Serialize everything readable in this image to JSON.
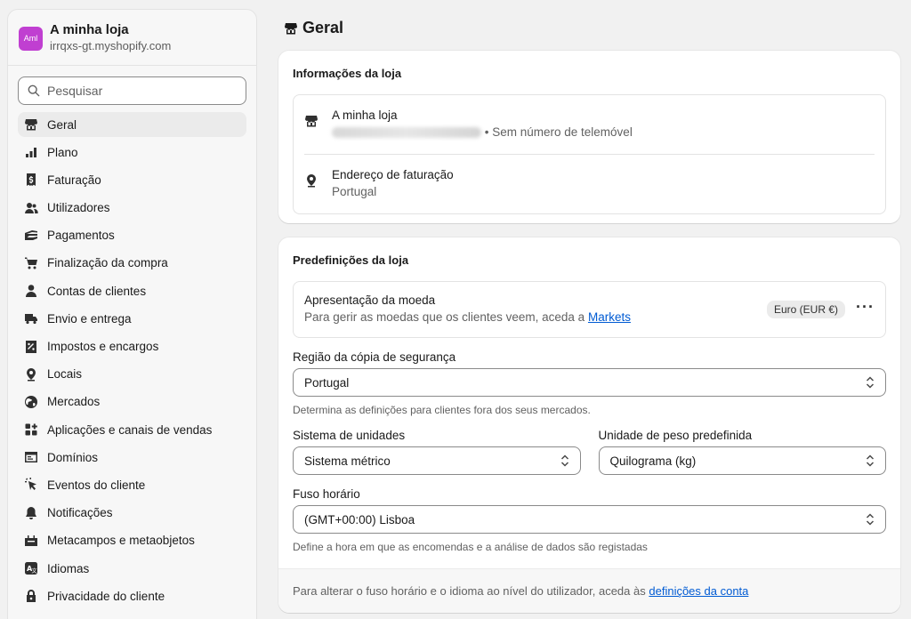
{
  "store": {
    "avatar_text": "Aml",
    "name": "A minha loja",
    "url": "irrqxs-gt.myshopify.com"
  },
  "search": {
    "placeholder": "Pesquisar"
  },
  "nav": [
    {
      "label": "Geral",
      "icon": "store-icon"
    },
    {
      "label": "Plano",
      "icon": "chart-icon"
    },
    {
      "label": "Faturação",
      "icon": "receipt-icon"
    },
    {
      "label": "Utilizadores",
      "icon": "users-icon"
    },
    {
      "label": "Pagamentos",
      "icon": "payments-icon"
    },
    {
      "label": "Finalização da compra",
      "icon": "cart-icon"
    },
    {
      "label": "Contas de clientes",
      "icon": "person-icon"
    },
    {
      "label": "Envio e entrega",
      "icon": "truck-icon"
    },
    {
      "label": "Impostos e encargos",
      "icon": "tax-icon"
    },
    {
      "label": "Locais",
      "icon": "location-icon"
    },
    {
      "label": "Mercados",
      "icon": "globe-icon"
    },
    {
      "label": "Aplicações e canais de vendas",
      "icon": "apps-icon"
    },
    {
      "label": "Domínios",
      "icon": "domain-icon"
    },
    {
      "label": "Eventos do cliente",
      "icon": "cursor-icon"
    },
    {
      "label": "Notificações",
      "icon": "bell-icon"
    },
    {
      "label": "Metacampos e metaobjetos",
      "icon": "metafield-icon"
    },
    {
      "label": "Idiomas",
      "icon": "language-icon"
    },
    {
      "label": "Privacidade do cliente",
      "icon": "lock-icon"
    }
  ],
  "page": {
    "title": "Geral"
  },
  "store_info": {
    "title": "Informações da loja",
    "name": "A minha loja",
    "phone": "• Sem número de telemóvel",
    "billing_title": "Endereço de faturação",
    "billing_value": "Portugal"
  },
  "defaults": {
    "title": "Predefinições da loja",
    "currency_title": "Apresentação da moeda",
    "currency_sub": "Para gerir as moedas que os clientes veem, aceda a",
    "currency_link": "Markets",
    "currency_badge": "Euro (EUR €)",
    "backup_label": "Região da cópia de segurança",
    "backup_value": "Portugal",
    "backup_help": "Determina as definições para clientes fora dos seus mercados.",
    "units_label": "Sistema de unidades",
    "units_value": "Sistema métrico",
    "weight_label": "Unidade de peso predefinida",
    "weight_value": "Quilograma (kg)",
    "tz_label": "Fuso horário",
    "tz_value": "(GMT+00:00) Lisboa",
    "tz_help": "Define a hora em que as encomendas e a análise de dados são registadas",
    "footer_text": "Para alterar o fuso horário e o idioma ao nível do utilizador, aceda às",
    "footer_link": "definições da conta"
  }
}
